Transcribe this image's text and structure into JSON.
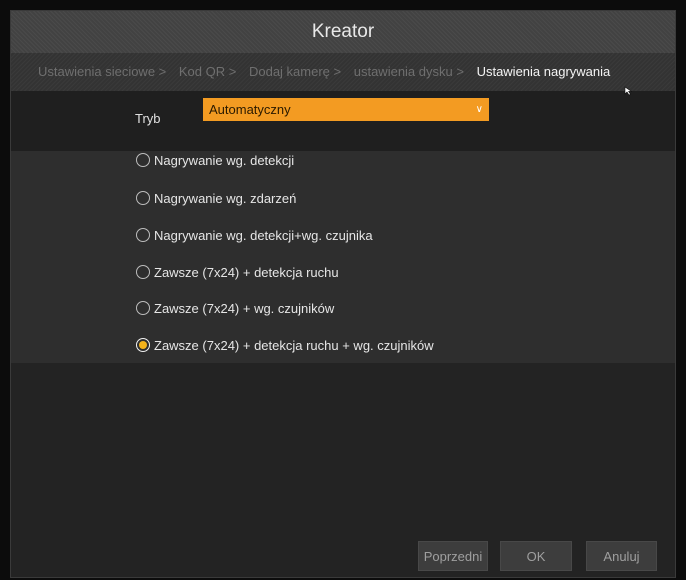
{
  "window": {
    "title": "Kreator"
  },
  "steps": [
    {
      "label": "Ustawienia sieciowe >",
      "active": false
    },
    {
      "label": "Kod QR >",
      "active": false
    },
    {
      "label": "Dodaj kamerę >",
      "active": false
    },
    {
      "label": "ustawienia dysku >",
      "active": false
    },
    {
      "label": "Ustawienia nagrywania",
      "active": true
    }
  ],
  "mode": {
    "label": "Tryb",
    "value": "Automatyczny"
  },
  "options": [
    {
      "label": "Nagrywanie wg. detekcji",
      "selected": false
    },
    {
      "label": "Nagrywanie wg. zdarzeń",
      "selected": false
    },
    {
      "label": "Nagrywanie wg. detekcji+wg. czujnika",
      "selected": false
    },
    {
      "label": "Zawsze (7x24) + detekcja ruchu",
      "selected": false
    },
    {
      "label": "Zawsze (7x24) + wg. czujników",
      "selected": false
    },
    {
      "label": "Zawsze (7x24) + detekcja ruchu + wg. czujników",
      "selected": true
    }
  ],
  "buttons": {
    "prev": "Poprzedni",
    "ok": "OK",
    "cancel": "Anuluj"
  },
  "colors": {
    "accent": "#f39b22",
    "radio_selected": "#f3b21b"
  }
}
